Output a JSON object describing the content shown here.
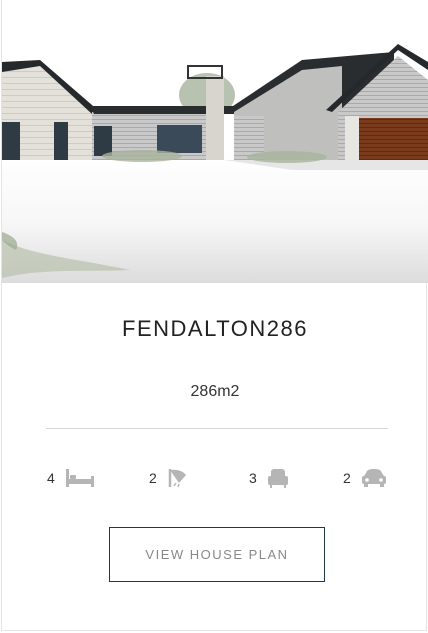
{
  "plan": {
    "title": "FENDALTON286",
    "area": "286m2",
    "features": {
      "bedrooms": "4",
      "bathrooms": "2",
      "living": "3",
      "garage": "2"
    },
    "button_label": "VIEW HOUSE PLAN"
  },
  "icons": {
    "bedrooms": "bed-icon",
    "bathrooms": "shower-icon",
    "living": "armchair-icon",
    "garage": "car-icon"
  },
  "colors": {
    "button_border": "#1e3a4a",
    "icon_gray": "#b5b5b5",
    "roof": "#2a2d30",
    "garage_door": "#7a3a1c"
  }
}
